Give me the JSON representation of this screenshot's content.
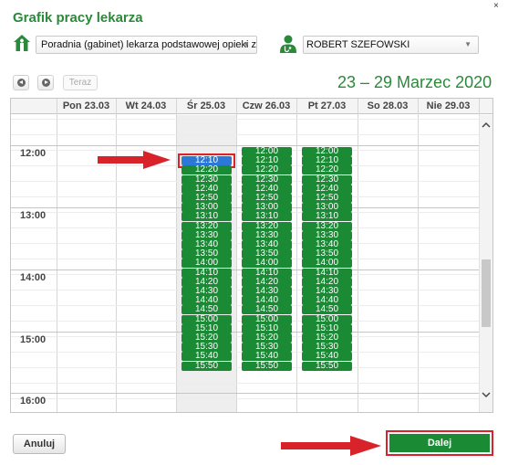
{
  "page": {
    "title": "Grafik pracy lekarza",
    "close_glyph": "×"
  },
  "filters": {
    "clinic": "Poradnia (gabinet) lekarza podstawowej opieki z...",
    "doctor": "ROBERT SZEFOWSKI"
  },
  "toolbar": {
    "today_label": "Teraz",
    "date_range": "23 – 29 Marzec 2020"
  },
  "calendar": {
    "days": [
      "Pon 23.03",
      "Wt 24.03",
      "Śr 25.03",
      "Czw 26.03",
      "Pt 27.03",
      "So 28.03",
      "Nie 29.03"
    ],
    "hours": [
      "12:00",
      "13:00",
      "14:00",
      "15:00",
      "16:00"
    ],
    "today_index": 2,
    "slots": {
      "sr_25_03": [
        "12:10",
        "12:20",
        "12:30",
        "12:40",
        "12:50",
        "13:00",
        "13:10",
        "13:20",
        "13:30",
        "13:40",
        "13:50",
        "14:00",
        "14:10",
        "14:20",
        "14:30",
        "14:40",
        "14:50",
        "15:00",
        "15:10",
        "15:20",
        "15:30",
        "15:40",
        "15:50"
      ],
      "czw_26_03": [
        "12:00",
        "12:10",
        "12:20",
        "12:30",
        "12:40",
        "12:50",
        "13:00",
        "13:10",
        "13:20",
        "13:30",
        "13:40",
        "13:50",
        "14:00",
        "14:10",
        "14:20",
        "14:30",
        "14:40",
        "14:50",
        "15:00",
        "15:10",
        "15:20",
        "15:30",
        "15:40",
        "15:50"
      ],
      "pt_27_03": [
        "12:00",
        "12:10",
        "12:20",
        "12:30",
        "12:40",
        "12:50",
        "13:00",
        "13:10",
        "13:20",
        "13:30",
        "13:40",
        "13:50",
        "14:00",
        "14:10",
        "14:20",
        "14:30",
        "14:40",
        "14:50",
        "15:00",
        "15:10",
        "15:20",
        "15:30",
        "15:40",
        "15:50"
      ]
    },
    "selected_slot": {
      "day": "Śr 25.03",
      "time": "12:10"
    }
  },
  "actions": {
    "cancel_label": "Anuluj",
    "next_label": "Dalej"
  },
  "colors": {
    "brand_green": "#2a8a3a",
    "slot_green": "#1a8a35",
    "selected_blue": "#2b78d8",
    "highlight_red": "#d9232a"
  }
}
